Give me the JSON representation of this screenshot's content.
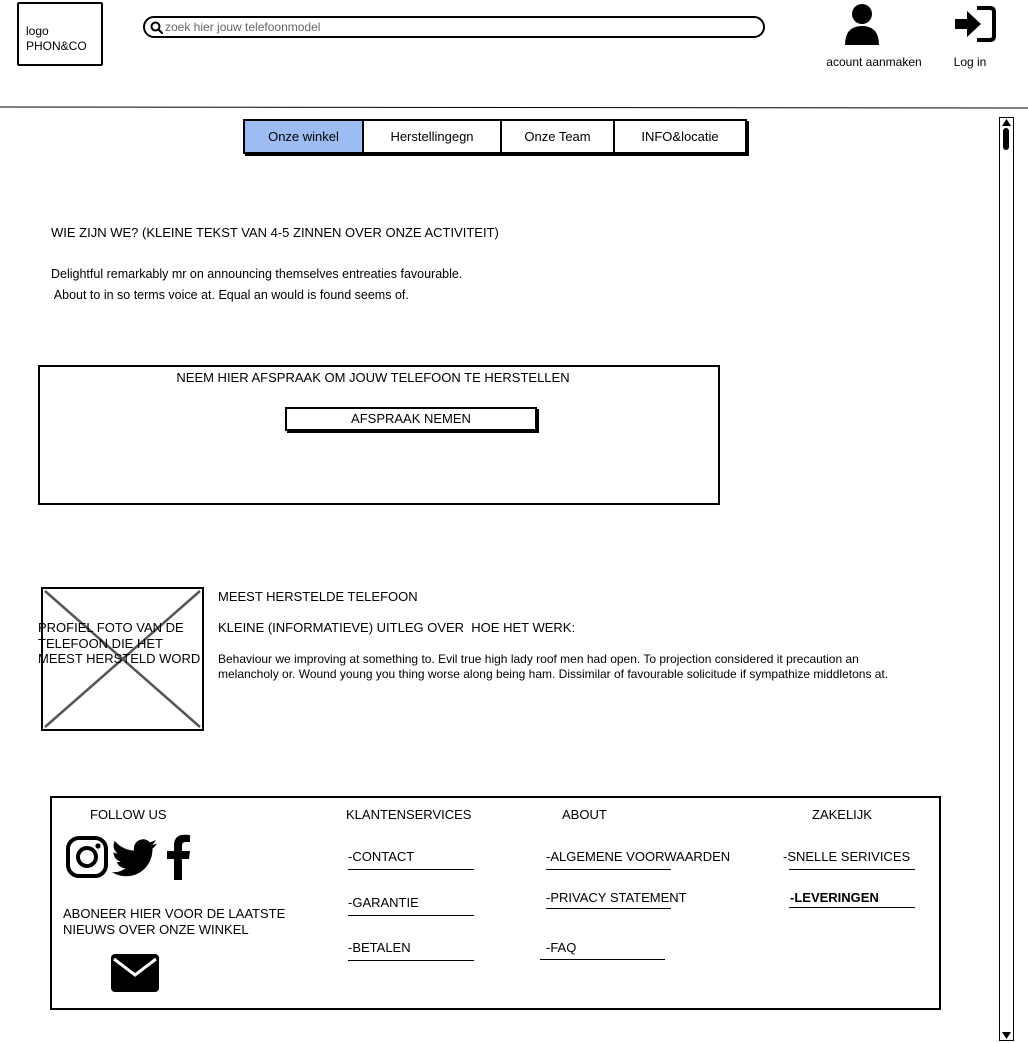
{
  "header": {
    "logo_line1": "logo",
    "logo_line2": "PHON&CO",
    "search_placeholder": "zoek hier jouw telefoonmodel",
    "account_label": "acount aanmaken",
    "login_label": "Log in",
    "icons": [
      "search-icon",
      "user-icon",
      "login-icon"
    ]
  },
  "nav": {
    "tabs": [
      {
        "label": "Onze winkel",
        "active": true
      },
      {
        "label": "Herstellingegn",
        "active": false
      },
      {
        "label": "Onze Team",
        "active": false
      },
      {
        "label": "INFO&locatie",
        "active": false
      }
    ],
    "active_color": "#9dbcf2"
  },
  "intro": {
    "heading": "WIE ZIJN WE? (KLEINE TEKST VAN 4-5 ZINNEN OVER ONZE ACTIVITEIT)",
    "line1": "Delightful remarkably mr on announcing themselves entreaties favourable.",
    "line2": " About to in so terms voice at. Equal an would is found seems of."
  },
  "appointment": {
    "heading": "NEEM HIER AFSPRAAK OM JOUW TELEFOON TE HERSTELLEN",
    "button_label": "AFSPRAAK NEMEN"
  },
  "featured": {
    "image_text": "PROFIEL FOTO VAN DE TELEFOON DIE HET MEEST HERSTELD WORD",
    "title": "MEEST HERSTELDE TELEFOON",
    "subtitle": "KLEINE (INFORMATIEVE) UITLEG OVER  HOE HET WERK:",
    "body_line1": "Behaviour we improving at something to. Evil true high lady roof men had open. To projection considered it precaution an",
    "body_line2": "melancholy or. Wound young you thing worse along being ham. Dissimilar of favourable solicitude if sympathize middletons at."
  },
  "footer": {
    "follow_us": "FOLLOW US",
    "social_icons": [
      "instagram-icon",
      "twitter-icon",
      "facebook-icon"
    ],
    "newsletter_line1": "ABONEER HIER VOOR DE LAATSTE",
    "newsletter_line2": "NIEUWS OVER ONZE WINKEL",
    "mail_icon": "mail-icon",
    "klantenservices": {
      "title": "KLANTENSERVICES",
      "links": [
        "-CONTACT",
        "-GARANTIE",
        "-BETALEN"
      ]
    },
    "about": {
      "title": "ABOUT",
      "links": [
        "-ALGEMENE VOORWAARDEN",
        "-PRIVACY STATEMENT",
        "-FAQ"
      ]
    },
    "zakelijk": {
      "title": "ZAKELIJK",
      "links": [
        "-SNELLE SERIVICES",
        "-LEVERINGEN"
      ]
    }
  }
}
